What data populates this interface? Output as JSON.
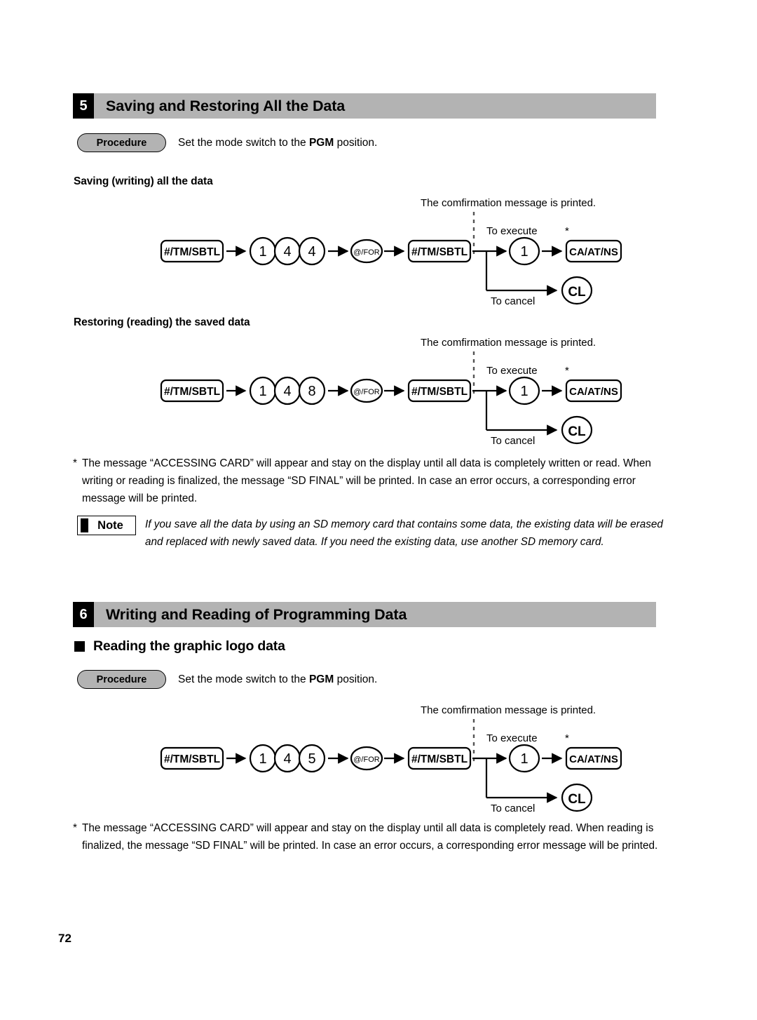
{
  "page": {
    "number": "72"
  },
  "sections": [
    {
      "number": "5",
      "title": "Saving and Restoring All the Data",
      "procedure": {
        "label": "Procedure",
        "text_before": "Set the mode switch to the ",
        "text_bold": "PGM",
        "text_after": " position."
      },
      "subheads": [
        "Saving (writing) all the data",
        "Restoring (reading) the saved data"
      ],
      "footnote": {
        "marker": "*",
        "text": "The message “ACCESSING CARD” will appear and stay on the display until all data is completely written or read. When writing or reading is finalized, the message “SD FINAL” will be printed. In case an error occurs, a corresponding error message will be printed."
      },
      "note": {
        "label": "Note",
        "text": "If you save all the data by using an SD memory card that contains some data, the existing data will be erased and replaced with newly saved data. If you need the existing data, use another SD memory card."
      }
    },
    {
      "number": "6",
      "title": "Writing and Reading of Programming Data",
      "bullet_heading": "Reading the graphic logo data",
      "procedure": {
        "label": "Procedure",
        "text_before": "Set the mode switch to the ",
        "text_bold": "PGM",
        "text_after": " position."
      },
      "footnote": {
        "marker": "*",
        "text": "The message “ACCESSING CARD” will appear and stay on the display until all data is completely read. When reading is finalized, the message “SD FINAL” will be printed. In case an error occurs, a corresponding error message will be printed."
      }
    }
  ],
  "diagrams": [
    {
      "id": "saving-all-data",
      "keys": {
        "start": "#/TM/SBTL",
        "digits": [
          "1",
          "4",
          "4"
        ],
        "at_for": "@/FOR",
        "confirm": "#/TM/SBTL",
        "execute_digit": "1",
        "execute_key": "CA/AT/NS",
        "cancel_key": "CL"
      },
      "labels": {
        "confirmation": "The comfirmation message is printed.",
        "to_execute": "To execute",
        "to_cancel": "To cancel",
        "asterisk": "*"
      }
    },
    {
      "id": "restoring-saved-data",
      "keys": {
        "start": "#/TM/SBTL",
        "digits": [
          "1",
          "4",
          "8"
        ],
        "at_for": "@/FOR",
        "confirm": "#/TM/SBTL",
        "execute_digit": "1",
        "execute_key": "CA/AT/NS",
        "cancel_key": "CL"
      },
      "labels": {
        "confirmation": "The comfirmation message is printed.",
        "to_execute": "To execute",
        "to_cancel": "To cancel",
        "asterisk": "*"
      }
    },
    {
      "id": "reading-graphic-logo",
      "keys": {
        "start": "#/TM/SBTL",
        "digits": [
          "1",
          "4",
          "5"
        ],
        "at_for": "@/FOR",
        "confirm": "#/TM/SBTL",
        "execute_digit": "1",
        "execute_key": "CA/AT/NS",
        "cancel_key": "CL"
      },
      "labels": {
        "confirmation": "The comfirmation message is printed.",
        "to_execute": "To execute",
        "to_cancel": "To cancel",
        "asterisk": "*"
      }
    }
  ],
  "colors": {
    "header_bar": "#b3b3b3",
    "badge": "#000000",
    "pill": "#b3b3b3",
    "text": "#000000"
  }
}
